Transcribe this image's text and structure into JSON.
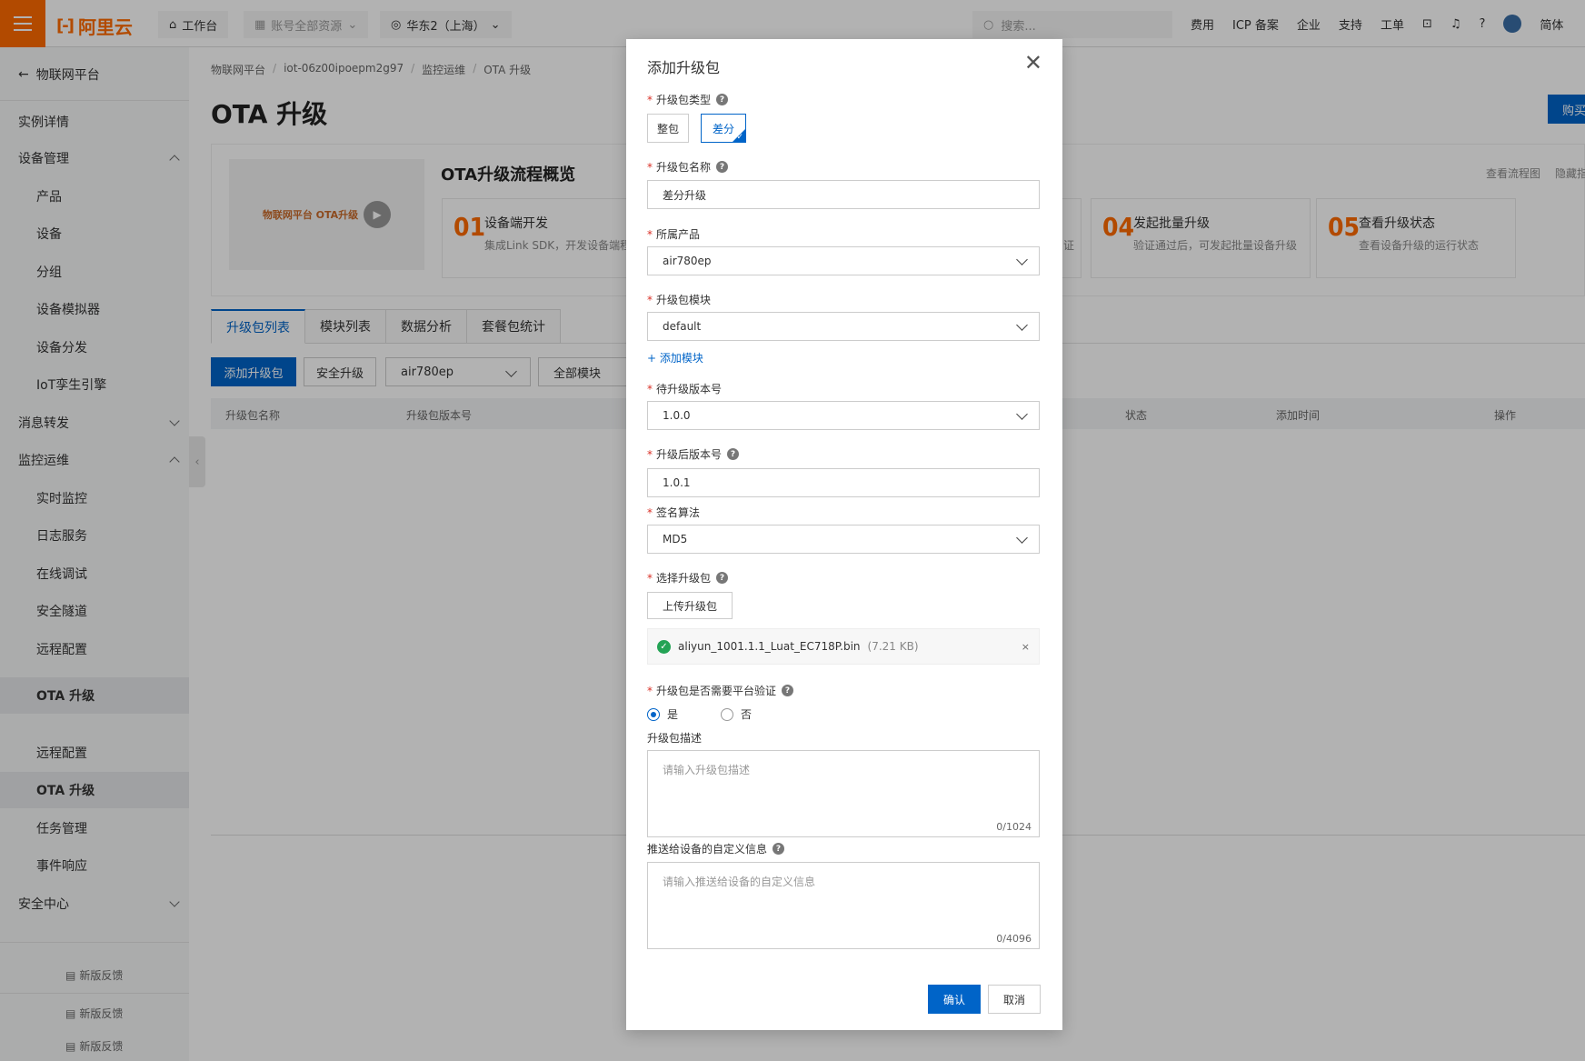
{
  "topbar": {
    "logo_text": "阿里云",
    "workbench": "工作台",
    "account_scope": "账号全部资源",
    "region": "华东2（上海）",
    "search_placeholder": "搜索...",
    "links": [
      "费用",
      "ICP 备案",
      "企业",
      "支持",
      "工单"
    ],
    "lang": "简体"
  },
  "sidebar": {
    "back": "物联网平台",
    "items": [
      {
        "label": "实例详情",
        "level": 1
      },
      {
        "label": "设备管理",
        "level": 1,
        "chevron": "up"
      },
      {
        "label": "产品",
        "level": 2
      },
      {
        "label": "设备",
        "level": 2
      },
      {
        "label": "分组",
        "level": 2
      },
      {
        "label": "设备模拟器",
        "level": 2
      },
      {
        "label": "设备分发",
        "level": 2
      },
      {
        "label": "IoT孪生引擎",
        "level": 2
      },
      {
        "label": "消息转发",
        "level": 1,
        "chevron": "down"
      },
      {
        "label": "监控运维",
        "level": 1,
        "chevron": "up"
      },
      {
        "label": "实时监控",
        "level": 2
      },
      {
        "label": "日志服务",
        "level": 2
      },
      {
        "label": "在线调试",
        "level": 2
      },
      {
        "label": "安全隧道",
        "level": 2
      },
      {
        "label": "远程配置",
        "level": 2
      },
      {
        "label": "OTA 升级",
        "level": 2,
        "selected": true
      },
      {
        "label": "远程配置",
        "level": 2
      },
      {
        "label": "OTA 升级",
        "level": 2,
        "selected": true
      },
      {
        "label": "任务管理",
        "level": 2
      },
      {
        "label": "事件响应",
        "level": 2
      },
      {
        "label": "安全中心",
        "level": 1,
        "chevron": "down"
      }
    ],
    "feedback": "新版反馈"
  },
  "breadcrumb": [
    "物联网平台",
    "iot-06z00ipoepm2g97",
    "监控运维",
    "OTA 升级"
  ],
  "page_title": "OTA 升级",
  "buy_button": "购买",
  "overview": {
    "title": "OTA升级流程概览",
    "thumb_text": "物联网平台 OTA升级",
    "links": [
      "查看流程图",
      "隐藏指引"
    ],
    "steps": [
      {
        "num": "01",
        "title": "设备端开发",
        "desc": "集成Link SDK，开发设备端程序"
      },
      {
        "num": "04",
        "title": "发起批量升级",
        "desc": "验证通过后，可发起批量设备升级"
      },
      {
        "num": "05",
        "title": "查看升级状态",
        "desc": "查看设备升级的运行状态"
      }
    ],
    "partial_char": "证"
  },
  "tabs": [
    "升级包列表",
    "模块列表",
    "数据分析",
    "套餐包统计"
  ],
  "toolbar": {
    "add": "添加升级包",
    "secure": "安全升级",
    "product": "air780ep",
    "module": "全部模块"
  },
  "table_headers": [
    "升级包名称",
    "升级包版本号",
    "状态",
    "添加时间",
    "操作"
  ],
  "modal": {
    "title": "添加升级包",
    "type_label": "升级包类型",
    "type_options": [
      "整包",
      "差分"
    ],
    "type_selected": "差分",
    "name_label": "升级包名称",
    "name_value": "差分升级",
    "product_label": "所属产品",
    "product_value": "air780ep",
    "module_label": "升级包模块",
    "module_value": "default",
    "add_module": "+ 添加模块",
    "from_label": "待升级版本号",
    "from_value": "1.0.0",
    "to_label": "升级后版本号",
    "to_value": "1.0.1",
    "sign_label": "签名算法",
    "sign_value": "MD5",
    "file_label": "选择升级包",
    "upload": "上传升级包",
    "file_name": "aliyun_1001.1.1_Luat_EC718P.bin",
    "file_size": "(7.21 KB)",
    "verify_label": "升级包是否需要平台验证",
    "verify_yes": "是",
    "verify_no": "否",
    "desc_label": "升级包描述",
    "desc_placeholder": "请输入升级包描述",
    "desc_count": "0/1024",
    "custom_label": "推送给设备的自定义信息",
    "custom_placeholder": "请输入推送给设备的自定义信息",
    "custom_count": "0/4096",
    "ok": "确认",
    "cancel": "取消"
  }
}
